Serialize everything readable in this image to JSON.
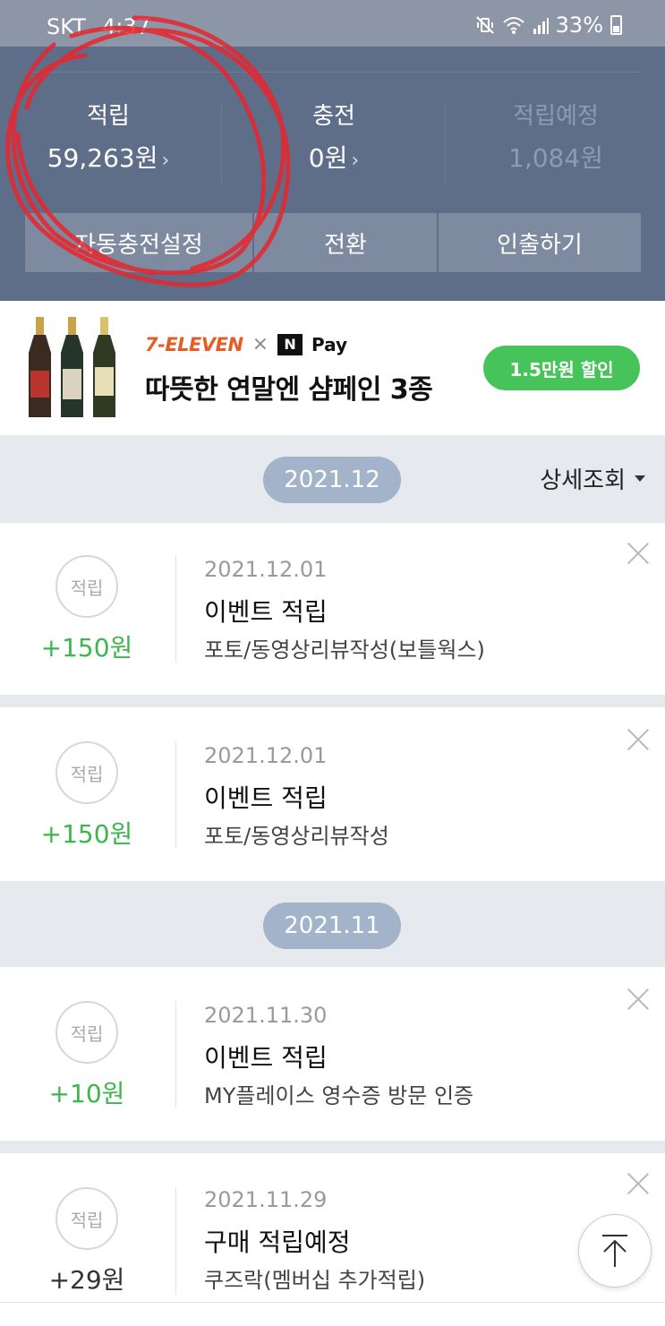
{
  "status_bar": {
    "carrier": "SKT",
    "time": "4:37",
    "icons": [
      "mute-vibrate-icon",
      "wifi-icon",
      "signal-icon"
    ],
    "battery": "33%"
  },
  "summary": {
    "stats": [
      {
        "label": "적립",
        "value": "59,263원",
        "has_chevron": true
      },
      {
        "label": "충전",
        "value": "0원",
        "has_chevron": true
      },
      {
        "label": "적립예정",
        "value": "1,084원",
        "has_chevron": false
      }
    ],
    "chevron": "›",
    "actions": [
      "자동충전설정",
      "전환",
      "인출하기"
    ],
    "annotation_color": "#e8262e"
  },
  "banner": {
    "brand": "7-ELEVEN",
    "times": "×",
    "npay_logo": "N",
    "npay_text": "Pay",
    "title": "따뜻한 연말엔 샴페인 3종",
    "cta": "1.5만원 할인"
  },
  "filter": {
    "label": "상세조회"
  },
  "months": [
    {
      "label": "2021.12",
      "items": [
        {
          "badge": "적립",
          "amount": "+150원",
          "amount_color": "green",
          "date": "2021.12.01",
          "title": "이벤트 적립",
          "desc": "포토/동영상리뷰작성(보틀웍스)"
        },
        {
          "badge": "적립",
          "amount": "+150원",
          "amount_color": "green",
          "date": "2021.12.01",
          "title": "이벤트 적립",
          "desc": "포토/동영상리뷰작성"
        }
      ]
    },
    {
      "label": "2021.11",
      "items": [
        {
          "badge": "적립",
          "amount": "+10원",
          "amount_color": "green",
          "date": "2021.11.30",
          "title": "이벤트 적립",
          "desc": "MY플레이스 영수증 방문 인증"
        },
        {
          "badge": "적립",
          "amount": "+29원",
          "amount_color": "dark",
          "date": "2021.11.29",
          "title": "구매 적립예정",
          "desc": "쿠즈락(멤버십 추가적립)"
        }
      ]
    }
  ],
  "colors": {
    "accent_green": "#3bb74b",
    "header_bg": "#5f6e88",
    "month_pill": "#a3b3c9"
  }
}
